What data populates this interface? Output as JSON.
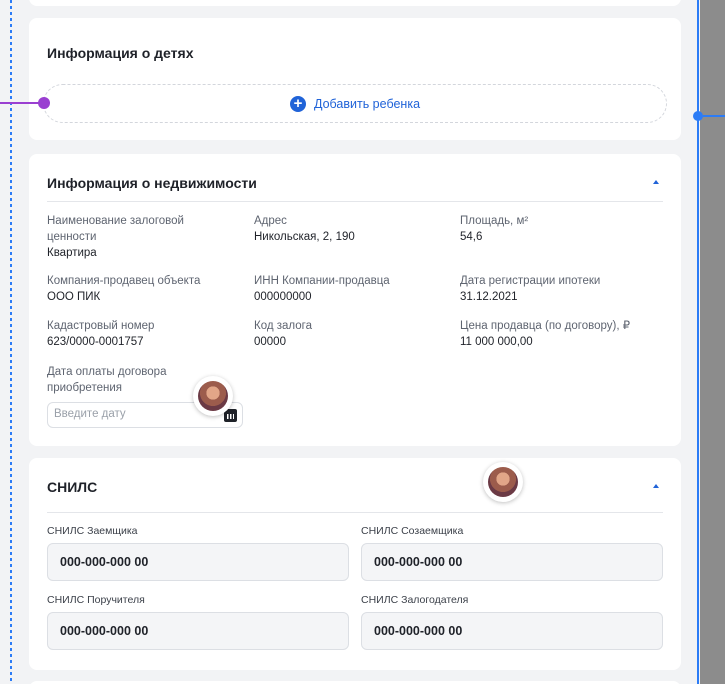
{
  "children_section": {
    "title": "Информация о детях",
    "add_child_label": "Добавить ребенка"
  },
  "property_section": {
    "title": "Информация о недвижимости",
    "fields": [
      {
        "label": "Наименование залоговой ценности",
        "value": "Квартира"
      },
      {
        "label": "Адрес",
        "value": "Никольская, 2, 190"
      },
      {
        "label": "Площадь, м²",
        "value": "54,6"
      },
      {
        "label": "Компания-продавец объекта",
        "value": "ООО ПИК"
      },
      {
        "label": "ИНН Компании-продавца",
        "value": "000000000"
      },
      {
        "label": "Дата регистрации ипотеки",
        "value": "31.12.2021"
      },
      {
        "label": "Кадастровый номер",
        "value": "623/0000-0001757"
      },
      {
        "label": "Код залога",
        "value": "00000"
      },
      {
        "label": "Цена продавца (по договору), ₽",
        "value": "11 000 000,00"
      }
    ],
    "payment_date": {
      "label": "Дата оплаты договора приобретения",
      "placeholder": "Введите дату"
    }
  },
  "snils_section": {
    "title": "СНИЛС",
    "fields": [
      {
        "label": "СНИЛС Заемщика",
        "value": "000-000-000 00"
      },
      {
        "label": "СНИЛС Созаемщика",
        "value": "000-000-000 00"
      },
      {
        "label": "СНИЛС Поручителя",
        "value": "000-000-000 00"
      },
      {
        "label": "СНИЛС Залогодателя",
        "value": "000-000-000 00"
      }
    ]
  },
  "colors": {
    "accent": "#2063d8",
    "selection_frame": "#2c7cf6",
    "connector": "#9a3fd1"
  },
  "icons": [
    "plus-circle-icon",
    "chevron-up-icon",
    "calendar-icon",
    "avatar"
  ]
}
